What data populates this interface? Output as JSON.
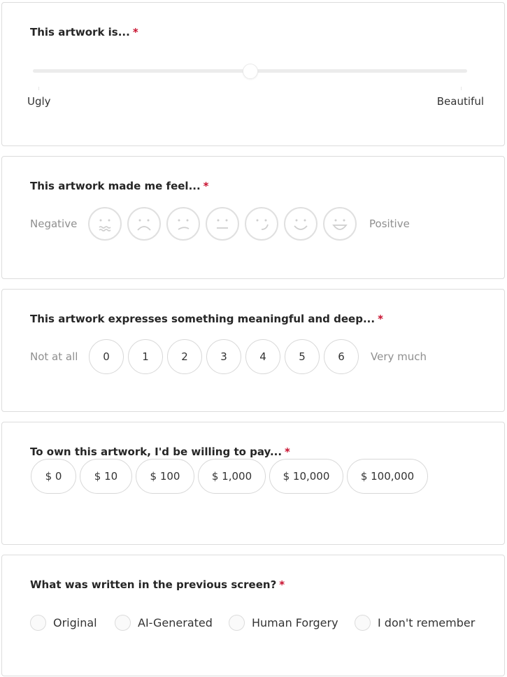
{
  "q1": {
    "title": "This artwork is...",
    "required": "*",
    "slider": {
      "min_label": "Ugly",
      "max_label": "Beautiful",
      "value_fraction": 0.5
    }
  },
  "q2": {
    "title": "This artwork made me feel...",
    "required": "*",
    "left_label": "Negative",
    "right_label": "Positive",
    "faces": [
      "wavy-mouth-face-icon",
      "frown-face-icon",
      "slight-frown-face-icon",
      "neutral-face-icon",
      "slight-smile-face-icon",
      "smile-face-icon",
      "grin-face-icon"
    ]
  },
  "q3": {
    "title": "This artwork expresses something meaningful and deep...",
    "required": "*",
    "left_label": "Not at all",
    "right_label": "Very much",
    "options": [
      "0",
      "1",
      "2",
      "3",
      "4",
      "5",
      "6"
    ]
  },
  "q4": {
    "title": "To own this artwork, I'd be willing to pay...",
    "required": "*",
    "options": [
      "$ 0",
      "$ 10",
      "$ 100",
      "$ 1,000",
      "$ 10,000",
      "$ 100,000"
    ]
  },
  "q5": {
    "title": "What was written in the previous screen?",
    "required": "*",
    "options": [
      "Original",
      "AI-Generated",
      "Human Forgery",
      "I don't remember"
    ]
  },
  "colors": {
    "required": "#c8102e",
    "border": "#dcdcdc",
    "muted_text": "#8f8f8f"
  }
}
